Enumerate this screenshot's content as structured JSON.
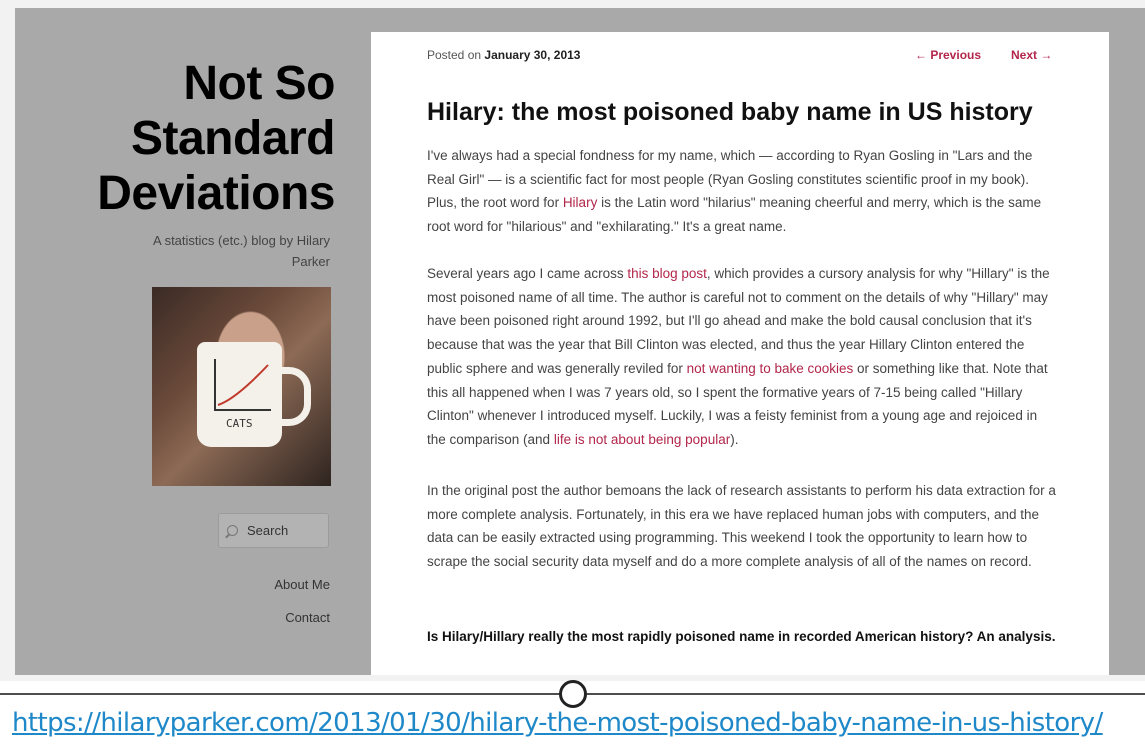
{
  "sidebar": {
    "title_line1": "Not So",
    "title_line2": "Standard",
    "title_line3": "Deviations",
    "tagline": "A statistics (etc.) blog by Hilary Parker",
    "mug_label": "CATS",
    "search_label": "Search",
    "links": [
      "About Me",
      "Contact"
    ]
  },
  "post": {
    "posted_prefix": "Posted on",
    "date": "January 30, 2013",
    "prev_label": "← Previous",
    "next_label": "Next →",
    "title": "Hilary: the most poisoned baby name in US history",
    "p1": [
      "I've always had a special fondness for my name, which — according to Ryan Gosling in \"Lars and the Real Girl\" — is a scientific fact for most people (Ryan Gosling constitutes scientific proof in my book). Plus, the root word for ",
      "Hilary",
      " is the Latin word \"hilarius\" meaning cheerful and merry, which is the same root word for \"hilarious\" and \"exhilarating.\" It's a great name."
    ],
    "p2": [
      "Several years ago I came across ",
      "this blog post",
      ", which provides a cursory analysis for why \"Hillary\" is the most poisoned name of all time. The author is careful not to comment on the details of why \"Hillary\" may have been poisoned right around 1992, but I'll go ahead and make the bold causal conclusion that it's because that was the year that Bill Clinton was elected, and thus the year Hillary Clinton entered the public sphere and was generally reviled for ",
      "not wanting to bake cookies",
      " or something like that. Note that this all happened when I was 7 years old, so I spent the formative years of 7-15 being called \"Hillary Clinton\" whenever I introduced myself. Luckily, I was a feisty feminist from a young age and rejoiced in the comparison (and ",
      "life is not about being popular",
      ")."
    ],
    "p3": "In the original post the author bemoans the lack of research assistants to perform his data extraction for a more complete analysis. Fortunately, in this era we have replaced human jobs with computers, and the data can be easily extracted using programming. This weekend I took the opportunity to learn how to scrape the social security data myself and do a more complete analysis of all of the names on record.",
    "subheading": "Is Hilary/Hillary really the most rapidly poisoned name in recorded American history? An analysis."
  },
  "footer": {
    "url": "https://hilaryparker.com/2013/01/30/hilary-the-most-poisoned-baby-name-in-us-history/"
  },
  "colors": {
    "link": "#b2264a",
    "sidebar_bg": "#a9a9a9",
    "url": "#1e88c8"
  }
}
